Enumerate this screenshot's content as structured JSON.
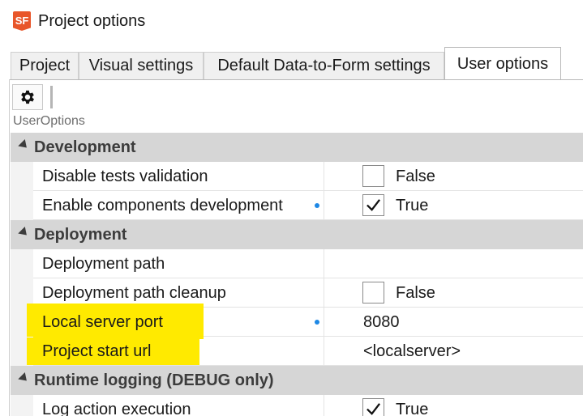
{
  "window": {
    "title": "Project options",
    "icon": "SF"
  },
  "tabs": [
    {
      "label": "Project",
      "active": false
    },
    {
      "label": "Visual settings",
      "active": false
    },
    {
      "label": "Default Data-to-Form settings",
      "active": false
    },
    {
      "label": "User options",
      "active": true
    }
  ],
  "toolbar": {
    "settings_icon": "gear-icon"
  },
  "component_label": "UserOptions",
  "grid": {
    "categories": {
      "development": "Development",
      "deployment": "Deployment",
      "runtime_logging": "Runtime logging (DEBUG only)"
    },
    "rows": {
      "disable_tests": {
        "name": "Disable tests validation",
        "value": "False",
        "checked": false
      },
      "enable_components": {
        "name": "Enable components development",
        "value": "True",
        "checked": true,
        "modified": true
      },
      "deployment_path": {
        "name": "Deployment path",
        "value": ""
      },
      "deployment_cleanup": {
        "name": "Deployment path cleanup",
        "value": "False",
        "checked": false
      },
      "local_server_port": {
        "name": "Local server port",
        "value": "8080",
        "modified": true,
        "highlighted": true
      },
      "project_start_url": {
        "name": "Project start url",
        "value": "<localserver>",
        "highlighted": true
      },
      "log_action": {
        "name": "Log action execution",
        "value": "True",
        "checked": true
      }
    }
  },
  "colors": {
    "highlight": "#ffea00",
    "category_bg": "#d6d6d6",
    "modified_dot": "#1e88e5",
    "app_icon": "#e8562a"
  }
}
